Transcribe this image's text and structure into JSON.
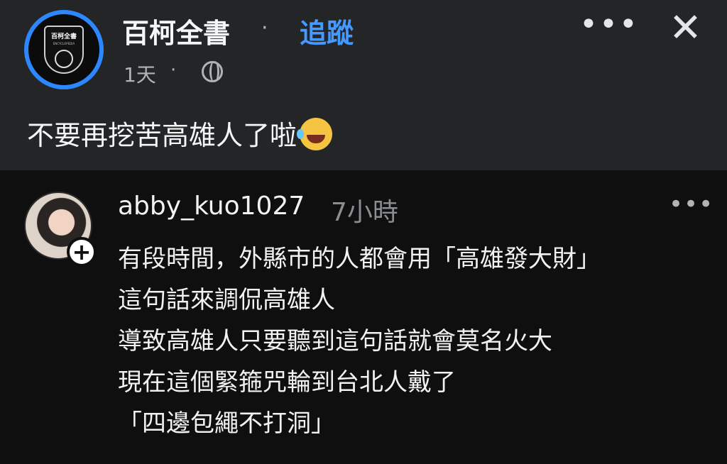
{
  "post": {
    "page_name": "百柯全書",
    "separator": "·",
    "follow_label": "追蹤",
    "time": "1天",
    "time_separator": "·",
    "text": "不要再挖苦高雄人了啦",
    "logo_text": "百柯全書",
    "logo_sub": "ENCYCLOPEDIA"
  },
  "comment": {
    "username": "abby_kuo1027",
    "time": "7小時",
    "plus_label": "+",
    "lines": [
      "有段時間，外縣市的人都會用「高雄發大財」",
      "這句話來調侃高雄人",
      "導致高雄人只要聽到這句話就會莫名火大",
      "現在這個緊箍咒輪到台北人戴了",
      "「四邊包繩不打洞」"
    ]
  },
  "icons": {
    "more": "more-icon",
    "close": "close-icon",
    "globe": "globe-icon",
    "emoji": "rolling-laughing-emoji"
  },
  "colors": {
    "post_bg": "#242526",
    "comment_bg": "#0f0f10",
    "accent_blue": "#4599ff",
    "ring_blue": "#2d88ff",
    "secondary_text": "#b0b3b8"
  }
}
